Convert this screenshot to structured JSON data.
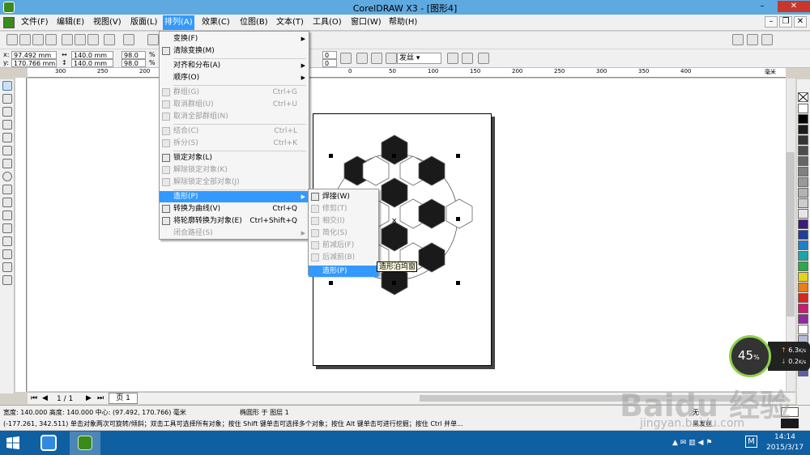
{
  "window": {
    "title": "CorelDRAW X3 - [图形4]"
  },
  "menubar": {
    "items": [
      "文件(F)",
      "编辑(E)",
      "视图(V)",
      "版面(L)",
      "排列(A)",
      "效果(C)",
      "位图(B)",
      "文本(T)",
      "工具(O)",
      "窗口(W)",
      "帮助(H)"
    ],
    "active": "排列(A)"
  },
  "propbar": {
    "x": "97.492 mm",
    "y": "170.766 mm",
    "x_label": "x:",
    "y_label": "y:",
    "w": "140.0 mm",
    "h": "140.0 mm",
    "scale_w": "98.0",
    "scale_h": "98.0",
    "pct": "%",
    "val1": "0",
    "val2": "0",
    "outline": "发丝"
  },
  "ruler": {
    "top": [
      "300",
      "250",
      "200",
      "0",
      "50",
      "100",
      "150",
      "200",
      "250",
      "300",
      "350",
      "400",
      "毫米"
    ]
  },
  "arrange_menu": {
    "items": [
      {
        "label": "变换(F)",
        "shortcut": "",
        "disabled": false,
        "submenu": true
      },
      {
        "label": "清除变换(M)",
        "shortcut": "",
        "disabled": false,
        "submenu": false
      },
      {
        "label": "对齐和分布(A)",
        "shortcut": "",
        "disabled": false,
        "submenu": true
      },
      {
        "label": "顺序(O)",
        "shortcut": "",
        "disabled": false,
        "submenu": true
      },
      {
        "label": "群组(G)",
        "shortcut": "Ctrl+G",
        "disabled": true,
        "submenu": false
      },
      {
        "label": "取消群组(U)",
        "shortcut": "Ctrl+U",
        "disabled": true,
        "submenu": false
      },
      {
        "label": "取消全部群组(N)",
        "shortcut": "",
        "disabled": true,
        "submenu": false
      },
      {
        "label": "结合(C)",
        "shortcut": "Ctrl+L",
        "disabled": true,
        "submenu": false
      },
      {
        "label": "拆分(S)",
        "shortcut": "Ctrl+K",
        "disabled": true,
        "submenu": false
      },
      {
        "label": "锁定对象(L)",
        "shortcut": "",
        "disabled": false,
        "submenu": false
      },
      {
        "label": "解除锁定对象(K)",
        "shortcut": "",
        "disabled": true,
        "submenu": false
      },
      {
        "label": "解除锁定全部对象(J)",
        "shortcut": "",
        "disabled": true,
        "submenu": false
      },
      {
        "label": "造形(P)",
        "shortcut": "",
        "disabled": false,
        "submenu": true,
        "highlight": true
      },
      {
        "label": "转换为曲线(V)",
        "shortcut": "Ctrl+Q",
        "disabled": false,
        "submenu": false
      },
      {
        "label": "将轮廓转换为对象(E)",
        "shortcut": "Ctrl+Shift+Q",
        "disabled": false,
        "submenu": false
      },
      {
        "label": "闭合路径(S)",
        "shortcut": "",
        "disabled": true,
        "submenu": true
      }
    ]
  },
  "shaping_menu": {
    "items": [
      {
        "label": "焊接(W)",
        "disabled": false
      },
      {
        "label": "修剪(T)",
        "disabled": true
      },
      {
        "label": "相交(I)",
        "disabled": true
      },
      {
        "label": "简化(S)",
        "disabled": true
      },
      {
        "label": "前减后(F)",
        "disabled": true
      },
      {
        "label": "后减前(B)",
        "disabled": true
      },
      {
        "label": "造形(P)",
        "disabled": false,
        "highlight": true
      }
    ]
  },
  "tooltip": "造形泊坞窗",
  "page_nav": {
    "counter": "1 / 1",
    "tab": "页 1"
  },
  "status": {
    "line1_left": "宽度: 140.000  高度: 140.000  中心: (97.492, 170.766)  毫米",
    "line1_mid": "椭圆形 于 图层 1",
    "line2": "(-177.261, 342.511)   单击对象两次可旋转/倾斜；双击工具可选择所有对象；按住 Shift 键单击可选择多个对象；按住 Alt 键单击可进行挖掘；按住 Ctrl 并单...",
    "fill_none": "无",
    "outline_black": "黑发丝"
  },
  "perf": {
    "percent": "45",
    "unit": "%",
    "up": "6.3",
    "down": "0.2",
    "speed_unit": "K/s"
  },
  "taskbar": {
    "time": "14:14",
    "date": "2015/3/17",
    "ime": "M"
  },
  "watermark": {
    "brand": "Baidu 经验",
    "url": "jingyan.baidu.com"
  },
  "colors": {
    "title": "#5ea9e0",
    "menu_highlight": "#3399ff",
    "taskbar": "#0f5fa3",
    "palette": [
      "#ffffff",
      "#000000",
      "#1a1a1a",
      "#333333",
      "#4d4d4d",
      "#666666",
      "#808080",
      "#999999",
      "#b3b3b3",
      "#cccccc",
      "#e6e6e6",
      "#3a1d7a",
      "#1f3d9a",
      "#1e80c8",
      "#1aa6a6",
      "#2da84a",
      "#e6d21a",
      "#e67e1a",
      "#d7261e",
      "#c81c6e",
      "#8e2a9a",
      "#ffffff",
      "#b8b8d8",
      "#9a9ac8",
      "#7c7cb8",
      "#5e5ea8"
    ]
  }
}
